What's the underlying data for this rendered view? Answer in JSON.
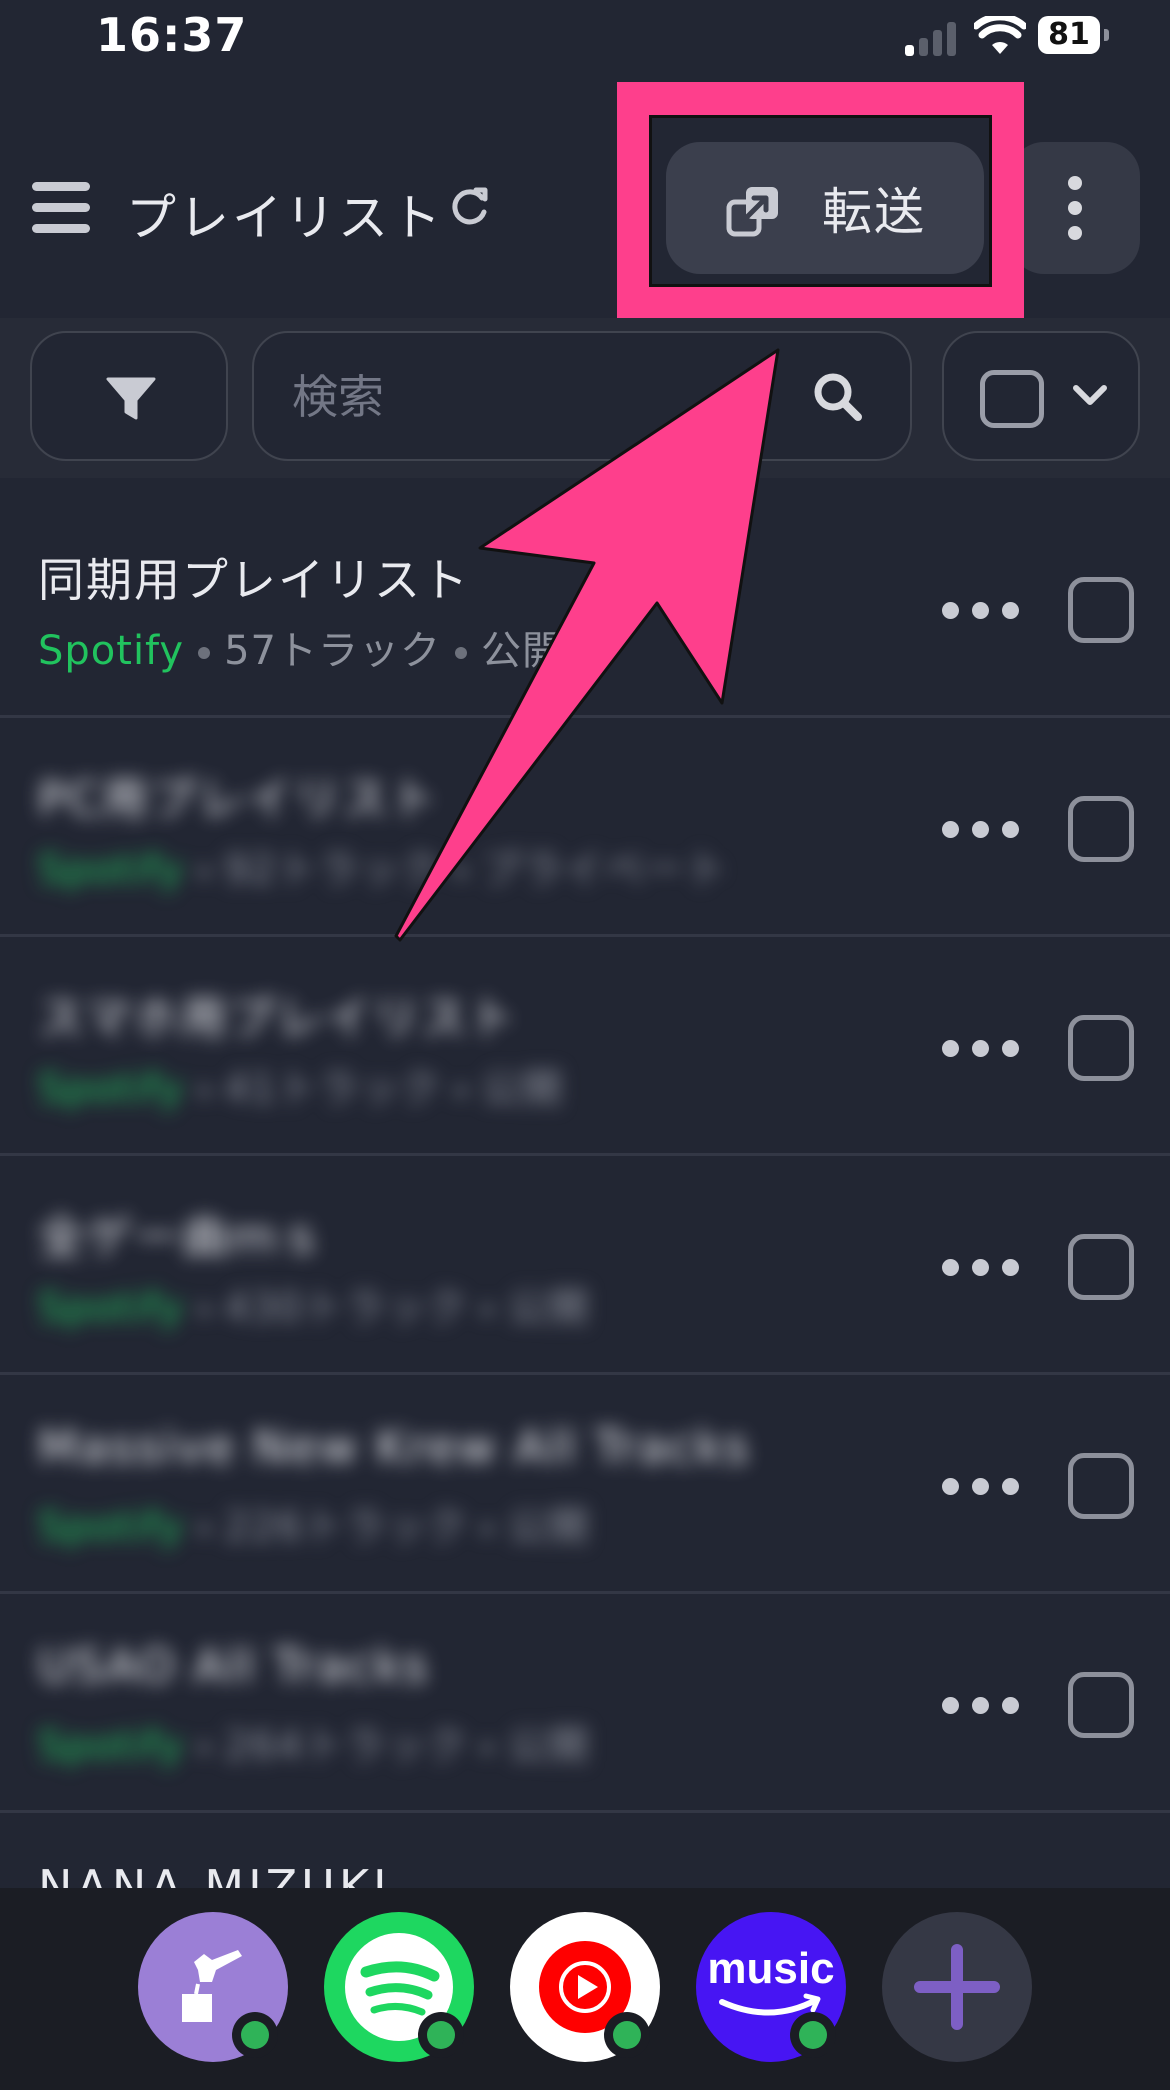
{
  "status_bar": {
    "time": "16:37",
    "battery": "81",
    "icons": [
      "signal-icon",
      "wifi-icon",
      "battery-icon"
    ]
  },
  "header": {
    "menu_icon": "hamburger-icon",
    "title": "プレイリスト",
    "refresh_icon": "refresh-icon",
    "transfer_label": "転送",
    "transfer_icon": "transfer-icon",
    "more_icon": "more-vertical-icon"
  },
  "filter_bar": {
    "filter_icon": "filter-icon",
    "search_placeholder": "検索",
    "search_icon": "search-icon",
    "select_all_icon": "checkbox-icon",
    "dropdown_icon": "chevron-down-icon"
  },
  "playlists": [
    {
      "title": "同期用プレイリスト",
      "service": "Spotify",
      "tracks": "57トラック",
      "visibility": "公開",
      "blurred": false
    },
    {
      "title": "PC用プレイリスト",
      "service": "Spotify",
      "tracks": "92トラック",
      "visibility": "プライベート",
      "blurred": true
    },
    {
      "title": "スマホ用プレイリスト",
      "service": "Spotify",
      "tracks": "41トラック",
      "visibility": "公開",
      "blurred": true
    },
    {
      "title": "全ゲー曲ｍｓ",
      "service": "Spotify",
      "tracks": "430トラック",
      "visibility": "公開",
      "blurred": true
    },
    {
      "title": "Massive New Krew All Tracks",
      "service": "Spotify",
      "tracks": "226トラック",
      "visibility": "公開",
      "blurred": true
    },
    {
      "title": "USAO All Tracks",
      "service": "Spotify",
      "tracks": "264トラック",
      "visibility": "公開",
      "blurred": true
    }
  ],
  "section_heading": "NANA MIZUKI",
  "dock": {
    "apps": [
      {
        "name": "transfer-app",
        "icon": "transfer-app-icon",
        "color": "#9b7fd6"
      },
      {
        "name": "spotify",
        "icon": "spotify-icon",
        "color": "#1ed760"
      },
      {
        "name": "youtube-music",
        "icon": "youtube-music-icon",
        "color": "#ffffff"
      },
      {
        "name": "amazon-music",
        "label": "music",
        "icon": "amazon-music-icon",
        "color": "#4715f3"
      }
    ],
    "add_icon": "plus-icon"
  },
  "annotation": {
    "highlight_color": "#fe3f8c",
    "arrow_color": "#fe3f8c"
  },
  "colors": {
    "background": "#222633",
    "service_green": "#21c35e",
    "text": "#e9eaef",
    "status_online": "#2fb358"
  }
}
